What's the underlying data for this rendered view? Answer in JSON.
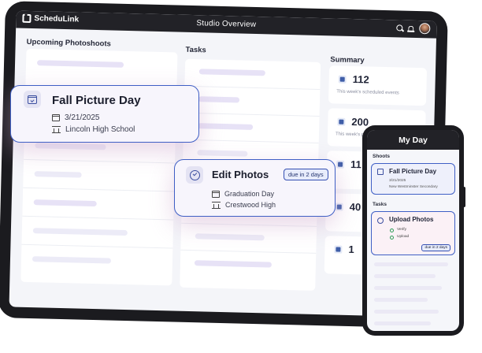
{
  "app": {
    "brand": "ScheduLink",
    "title": "Studio Overview"
  },
  "columns": {
    "photoshoots": "Upcoming Photoshoots",
    "tasks": "Tasks",
    "summary": "Summary"
  },
  "summary": [
    {
      "value": "112",
      "caption": "This week's scheduled events"
    },
    {
      "value": "200",
      "caption": "This week's photos uploaded"
    },
    {
      "value": "11",
      "caption": ""
    },
    {
      "value": "40",
      "caption": ""
    },
    {
      "value": "1",
      "caption": ""
    }
  ],
  "shoot_card": {
    "title": "Fall Picture Day",
    "date": "3/21/2025",
    "school": "Lincoln High School"
  },
  "task_card": {
    "title": "Edit Photos",
    "due": "due in 2 days",
    "event": "Graduation Day",
    "school": "Crestwood High"
  },
  "phone": {
    "title": "My Day",
    "shoots_label": "Shoots",
    "shoot": {
      "title": "Fall Picture Day",
      "date": "3/21/2025",
      "school": "New Westminster Secondary"
    },
    "tasks_label": "Tasks",
    "task": {
      "title": "Upload Photos",
      "steps": [
        "Verify",
        "Upload"
      ],
      "due": "due in 2 days"
    }
  }
}
